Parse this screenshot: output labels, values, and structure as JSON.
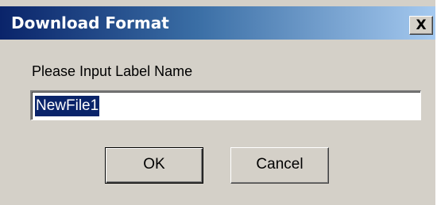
{
  "window": {
    "title": "Download Format",
    "close_glyph": "X",
    "close_icon": "close-icon"
  },
  "form": {
    "prompt_label": "Please Input Label Name",
    "label_name_value": "NewFile1"
  },
  "buttons": {
    "ok_label": "OK",
    "cancel_label": "Cancel"
  },
  "colors": {
    "titlebar_start": "#0a246a",
    "titlebar_end": "#a6caf0",
    "dialog_face": "#d4d0c8",
    "selection_bg": "#0a246a"
  }
}
